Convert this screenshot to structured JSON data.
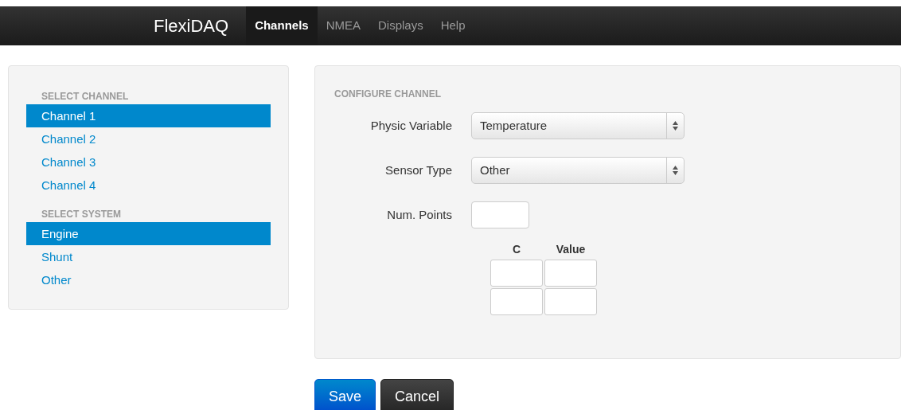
{
  "navbar": {
    "brand": "FlexiDAQ",
    "items": [
      {
        "label": "Channels",
        "selected": true
      },
      {
        "label": "NMEA",
        "selected": false
      },
      {
        "label": "Displays",
        "selected": false
      },
      {
        "label": "Help",
        "selected": false
      }
    ]
  },
  "sidebar": {
    "sections": [
      {
        "heading": "SELECT CHANNEL",
        "items": [
          {
            "label": "Channel 1",
            "selected": true
          },
          {
            "label": "Channel 2",
            "selected": false
          },
          {
            "label": "Channel 3",
            "selected": false
          },
          {
            "label": "Channel 4",
            "selected": false
          }
        ]
      },
      {
        "heading": "SELECT SYSTEM",
        "items": [
          {
            "label": "Engine",
            "selected": true
          },
          {
            "label": "Shunt",
            "selected": false
          },
          {
            "label": "Other",
            "selected": false
          }
        ]
      }
    ]
  },
  "form": {
    "heading": "CONFIGURE CHANNEL",
    "fields": [
      {
        "kind": "select",
        "label": "Physic Variable",
        "value": "Temperature"
      },
      {
        "kind": "select",
        "label": "Sensor Type",
        "value": "Other"
      },
      {
        "kind": "text",
        "label": "Num. Points"
      }
    ],
    "points_table": {
      "columns": [
        "C",
        "Value"
      ],
      "rows": [
        {
          "kind": "inputs"
        },
        {
          "kind": "inputs"
        }
      ]
    }
  },
  "buttons": [
    {
      "kind": "primary",
      "label": "Save"
    },
    {
      "kind": "dark",
      "label": "Cancel"
    }
  ]
}
